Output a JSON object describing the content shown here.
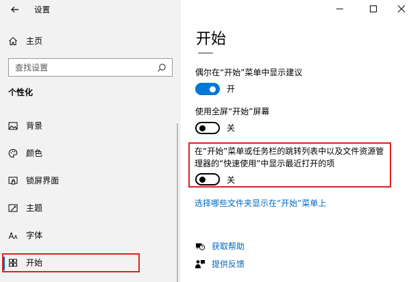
{
  "window": {
    "title": "设置"
  },
  "sidebar": {
    "home_label": "主页",
    "search": {
      "placeholder": "查找设置"
    },
    "section_title": "个性化",
    "items": [
      {
        "label": "背景",
        "icon": "image-icon"
      },
      {
        "label": "颜色",
        "icon": "palette-icon"
      },
      {
        "label": "锁屏界面",
        "icon": "lock-screen-icon"
      },
      {
        "label": "主题",
        "icon": "theme-icon"
      },
      {
        "label": "字体",
        "icon": "font-icon"
      },
      {
        "label": "开始",
        "icon": "start-icon",
        "active": true
      }
    ]
  },
  "main": {
    "title": "开始",
    "settings": [
      {
        "label": "偶尔在“开始”菜单中显示建议",
        "state": "开",
        "on": true
      },
      {
        "label": "使用全屏“开始”屏幕",
        "state": "关",
        "on": false
      },
      {
        "label_line1": "在“开始”菜单或任务栏的跳转列表中以及文件资源管",
        "label_line2": "理器的“快速使用”中显示最近打开的项",
        "state": "关",
        "on": false
      }
    ],
    "link": "选择哪些文件夹显示在“开始”菜单上",
    "help": [
      {
        "label": "获取帮助",
        "icon": "help-chat-icon"
      },
      {
        "label": "提供反馈",
        "icon": "feedback-icon"
      }
    ]
  },
  "colors": {
    "accent": "#0078d7",
    "highlight": "#e02020",
    "link": "#0067c0",
    "sidebar_bg": "#f2f2f2"
  }
}
